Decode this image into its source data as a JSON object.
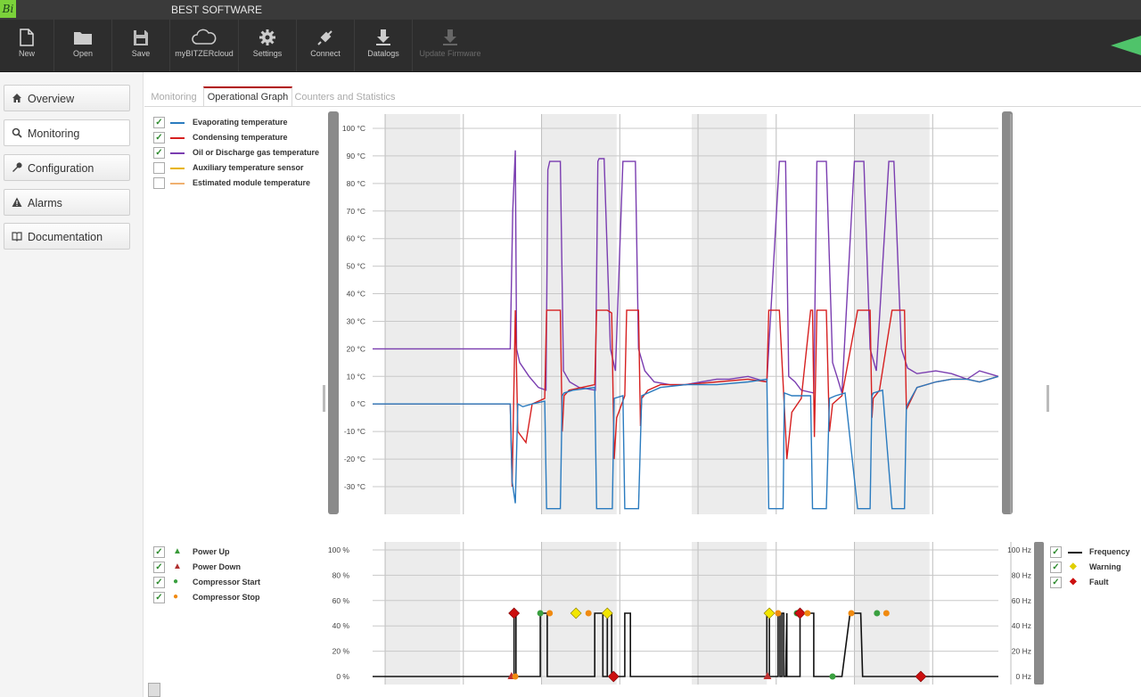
{
  "app": {
    "title": "BEST SOFTWARE",
    "logo_text": "Bi"
  },
  "toolbar": {
    "buttons": [
      {
        "label": "New",
        "icon": "new-file-icon",
        "enabled": true
      },
      {
        "label": "Open",
        "icon": "folder-icon",
        "enabled": true
      },
      {
        "label": "Save",
        "icon": "save-icon",
        "enabled": true
      },
      {
        "label": "myBITZERcloud",
        "icon": "cloud-icon",
        "enabled": true
      },
      {
        "label": "Settings",
        "icon": "gear-icon",
        "enabled": true
      },
      {
        "label": "Connect",
        "icon": "plug-icon",
        "enabled": true
      },
      {
        "label": "Datalogs",
        "icon": "download-icon",
        "enabled": true
      },
      {
        "label": "Update Firmware",
        "icon": "update-icon",
        "enabled": false
      }
    ]
  },
  "sidebar": {
    "items": [
      {
        "label": "Overview",
        "icon": "home-icon",
        "active": false
      },
      {
        "label": "Monitoring",
        "icon": "search-icon",
        "active": true
      },
      {
        "label": "Configuration",
        "icon": "wrench-icon",
        "active": false
      },
      {
        "label": "Alarms",
        "icon": "warning-icon",
        "active": false
      },
      {
        "label": "Documentation",
        "icon": "book-icon",
        "active": false
      }
    ]
  },
  "tabs": [
    {
      "label": "Monitoring",
      "active": false
    },
    {
      "label": "Operational Graph",
      "active": true
    },
    {
      "label": "Counters and Statistics",
      "active": false
    }
  ],
  "temp_legend": [
    {
      "label": "Evaporating temperature",
      "checked": true,
      "color": "#2a7bbf"
    },
    {
      "label": "Condensing temperature",
      "checked": true,
      "color": "#d62020"
    },
    {
      "label": "Oil or Discharge gas temperature",
      "checked": true,
      "color": "#7a3db0"
    },
    {
      "label": "Auxiliary temperature sensor",
      "checked": false,
      "color": "#e8b400"
    },
    {
      "label": "Estimated module temperature",
      "checked": false,
      "color": "#f0b070"
    }
  ],
  "event_legend": [
    {
      "label": "Power Up",
      "checked": true,
      "symbol": "▲",
      "color": "#3a9a3a"
    },
    {
      "label": "Power Down",
      "checked": true,
      "symbol": "▲",
      "color": "#b03030"
    },
    {
      "label": "Compressor Start",
      "checked": true,
      "symbol": "●",
      "color": "#3aa040"
    },
    {
      "label": "Compressor Stop",
      "checked": true,
      "symbol": "●",
      "color": "#f08a10"
    }
  ],
  "freq_legend": [
    {
      "label": "Frequency",
      "checked": true,
      "symbol": "line",
      "color": "#111111"
    },
    {
      "label": "Warning",
      "checked": true,
      "symbol": "◆",
      "color": "#e8d800"
    },
    {
      "label": "Fault",
      "checked": true,
      "symbol": "◆",
      "color": "#cc1010"
    }
  ],
  "chart_data": [
    {
      "type": "line",
      "yticks": [
        "100 °C",
        "90 °C",
        "80 °C",
        "70 °C",
        "60 °C",
        "50 °C",
        "40 °C",
        "30 °C",
        "20 °C",
        "10 °C",
        "0 °C",
        "-10 °C",
        "-20 °C",
        "-30 °C"
      ],
      "ylim": [
        -40,
        105
      ],
      "xlim": [
        0,
        100
      ],
      "grid": true,
      "series": [
        {
          "name": "Oil or Discharge gas temperature",
          "color": "#7a3db0",
          "x": [
            0,
            22,
            22.4,
            22.8,
            23,
            23.5,
            25,
            26.5,
            27.7,
            28,
            28.3,
            29,
            30,
            30.5,
            31.5,
            33,
            35.6,
            36,
            36.2,
            37,
            38,
            38.8,
            40,
            41,
            42,
            42.5,
            43.5,
            45,
            47.5,
            50,
            52.5,
            55,
            57,
            60,
            63,
            65,
            65.5,
            66,
            66.5,
            67.5,
            68.5,
            70.5,
            71,
            71.3,
            72.5,
            73.5,
            74.2,
            75,
            77,
            78,
            78.5,
            79.5,
            80.5,
            82.5,
            83,
            83.3,
            84.5,
            85.5,
            87,
            90,
            92.5,
            95,
            97,
            100
          ],
          "y": [
            20,
            20,
            70,
            92,
            20,
            15,
            10,
            6,
            5,
            85,
            88,
            88,
            88,
            12,
            8,
            6,
            5,
            88,
            89,
            89,
            20,
            12,
            88,
            88,
            88,
            20,
            12,
            8,
            7,
            7,
            8,
            9,
            9,
            10,
            8,
            88,
            88,
            88,
            10,
            8,
            5,
            4,
            88,
            88,
            88,
            15,
            10,
            4,
            88,
            88,
            88,
            20,
            12,
            88,
            88,
            88,
            20,
            13,
            11,
            12,
            11,
            9,
            12,
            10
          ]
        },
        {
          "name": "Condensing temperature",
          "color": "#d62020",
          "x": [
            0,
            22,
            22.3,
            22.8,
            23.2,
            24.5,
            25.5,
            27.5,
            27.8,
            28,
            29,
            30,
            30.3,
            30.6,
            31.4,
            35.5,
            35.8,
            36,
            37.5,
            38.2,
            38.6,
            39,
            40.3,
            40.6,
            41,
            42.5,
            42.8,
            43,
            44,
            46,
            50,
            55,
            60,
            63,
            63.3,
            63.7,
            64,
            65,
            66,
            66.2,
            67,
            68.5,
            70,
            70.3,
            70.6,
            71,
            72.5,
            73,
            73.5,
            75,
            77.5,
            77.8,
            78,
            79.5,
            79.8,
            80,
            81,
            83,
            83.3,
            83.5,
            85,
            85.3,
            87,
            90,
            92.5,
            95,
            97,
            100
          ],
          "y": [
            0,
            0,
            -30,
            34,
            -10,
            -14,
            0,
            2,
            34,
            34,
            34,
            34,
            -10,
            3,
            5,
            7,
            34,
            34,
            34,
            33,
            -20,
            -5,
            3,
            34,
            34,
            34,
            -8,
            2,
            5,
            7,
            7,
            8,
            9,
            8,
            34,
            34,
            34,
            34,
            -10,
            -20,
            -3,
            2,
            34,
            34,
            -12,
            34,
            34,
            -10,
            0,
            3,
            34,
            34,
            34,
            34,
            -5,
            2,
            5,
            34,
            34,
            34,
            34,
            -2,
            6,
            8,
            9,
            9,
            8,
            10
          ]
        },
        {
          "name": "Evaporating temperature",
          "color": "#2a7bbf",
          "x": [
            0,
            22,
            22.3,
            22.8,
            23.2,
            24,
            25.5,
            27.5,
            27.8,
            28,
            29.5,
            30,
            30.3,
            30.6,
            32,
            35.5,
            35.8,
            36,
            37.5,
            38,
            38.3,
            38.6,
            40,
            40.3,
            40.6,
            42,
            42.5,
            43,
            46,
            50,
            55,
            60,
            63,
            63.3,
            63.5,
            65,
            65.6,
            65.8,
            67,
            68.5,
            70,
            70.3,
            70.5,
            72,
            72.5,
            73,
            74,
            75.5,
            77.5,
            77.8,
            78,
            79.5,
            79.8,
            80,
            81.5,
            83,
            83.3,
            83.5,
            85,
            85.3,
            87,
            90,
            92.5,
            95,
            97,
            100
          ],
          "y": [
            0,
            0,
            -28,
            -36,
            0,
            -1,
            0,
            1,
            -38,
            -38,
            -38,
            -38,
            3,
            4,
            5,
            6,
            -38,
            -38,
            -38,
            -38,
            -38,
            2,
            3,
            -38,
            -38,
            -38,
            -38,
            3,
            6,
            7,
            7,
            8,
            9,
            -38,
            -38,
            -38,
            -38,
            4,
            3,
            3,
            3,
            -38,
            -38,
            -38,
            -38,
            2,
            3,
            4,
            -38,
            -38,
            -38,
            -38,
            3,
            4,
            5,
            -38,
            -38,
            -38,
            -38,
            -1,
            6,
            8,
            9,
            9,
            8,
            10
          ]
        }
      ]
    },
    {
      "type": "line",
      "yticks_left": [
        "100 %",
        "80 %",
        "60 %",
        "40 %",
        "20 %",
        "0 %"
      ],
      "yticks_right": [
        "100 Hz",
        "80 Hz",
        "60 Hz",
        "40 Hz",
        "20 Hz",
        "0 Hz"
      ],
      "ylim": [
        0,
        100
      ],
      "xlim": [
        0,
        100
      ],
      "grid": true,
      "series": [
        {
          "name": "Frequency",
          "color": "#111111",
          "x": [
            0,
            22,
            22,
            22.6,
            22.6,
            22.9,
            22.9,
            23.4,
            23.4,
            25,
            25,
            26,
            26.8,
            26.8,
            27.9,
            27.9,
            28.3,
            28.3,
            29,
            30,
            30.7,
            30.7,
            31,
            32,
            33,
            35.5,
            35.5,
            36,
            36.8,
            36.8,
            37.5,
            37.5,
            38.2,
            38.2,
            38.5,
            38.8,
            38.8,
            39,
            40,
            40.3,
            40.3,
            40.8,
            41.2,
            41.2,
            42,
            42.5,
            42.8,
            42.8,
            43,
            44,
            44.8,
            44.8,
            46,
            50,
            55,
            60,
            63,
            63,
            63.4,
            63.4,
            64,
            64.5,
            64.8,
            64.8,
            65.1,
            65.1,
            65.4,
            65.4,
            65.7,
            65.7,
            66,
            66.2,
            66.2,
            67,
            68.3,
            68.3,
            69,
            70.5,
            70.5,
            71,
            71,
            71.8,
            72.5,
            72.5,
            73,
            73.5,
            73.5,
            74,
            75,
            76.3,
            76.3,
            77,
            78,
            78,
            78.3,
            78.3,
            78.5,
            80,
            85,
            90,
            95,
            100
          ],
          "y": [
            0,
            0,
            0,
            0,
            50,
            50,
            0,
            0,
            0,
            0,
            0,
            0,
            0,
            50,
            50,
            0,
            0,
            0,
            0,
            0,
            0,
            0,
            0,
            0,
            0,
            0,
            50,
            50,
            50,
            0,
            0,
            50,
            50,
            0,
            0,
            0,
            0,
            0,
            0,
            0,
            50,
            50,
            50,
            0,
            0,
            0,
            0,
            0,
            0,
            0,
            0,
            0,
            0,
            0,
            0,
            0,
            0,
            50,
            50,
            0,
            0,
            0,
            0,
            50,
            50,
            0,
            0,
            50,
            50,
            0,
            0,
            50,
            0,
            0,
            0,
            50,
            50,
            50,
            0,
            0,
            0,
            0,
            0,
            0,
            0,
            0,
            0,
            0,
            0,
            50,
            50,
            50,
            50,
            50,
            0,
            0,
            0,
            0,
            0,
            0,
            0,
            0
          ]
        }
      ],
      "events": [
        {
          "type": "fault",
          "x": 22.6,
          "y": 50
        },
        {
          "type": "power_down",
          "x": 22.2,
          "y": 0
        },
        {
          "type": "compressor_stop",
          "x": 22.8,
          "y": 0
        },
        {
          "type": "compressor_start",
          "x": 26.8,
          "y": 50
        },
        {
          "type": "compressor_stop",
          "x": 28.3,
          "y": 50
        },
        {
          "type": "warning",
          "x": 32.5,
          "y": 50
        },
        {
          "type": "compressor_stop",
          "x": 34.5,
          "y": 50
        },
        {
          "type": "warning",
          "x": 37.5,
          "y": 50
        },
        {
          "type": "fault",
          "x": 38.5,
          "y": 0
        },
        {
          "type": "warning",
          "x": 63.4,
          "y": 50
        },
        {
          "type": "compressor_stop",
          "x": 64.8,
          "y": 50
        },
        {
          "type": "power_down",
          "x": 63.1,
          "y": 0
        },
        {
          "type": "compressor_start",
          "x": 67.8,
          "y": 50
        },
        {
          "type": "fault",
          "x": 68.3,
          "y": 50
        },
        {
          "type": "compressor_stop",
          "x": 69.5,
          "y": 50
        },
        {
          "type": "compressor_start",
          "x": 73.5,
          "y": 0
        },
        {
          "type": "compressor_stop",
          "x": 76.5,
          "y": 50
        },
        {
          "type": "compressor_start",
          "x": 80.6,
          "y": 50
        },
        {
          "type": "compressor_stop",
          "x": 82.1,
          "y": 50
        },
        {
          "type": "fault",
          "x": 87.6,
          "y": 0
        }
      ]
    }
  ]
}
